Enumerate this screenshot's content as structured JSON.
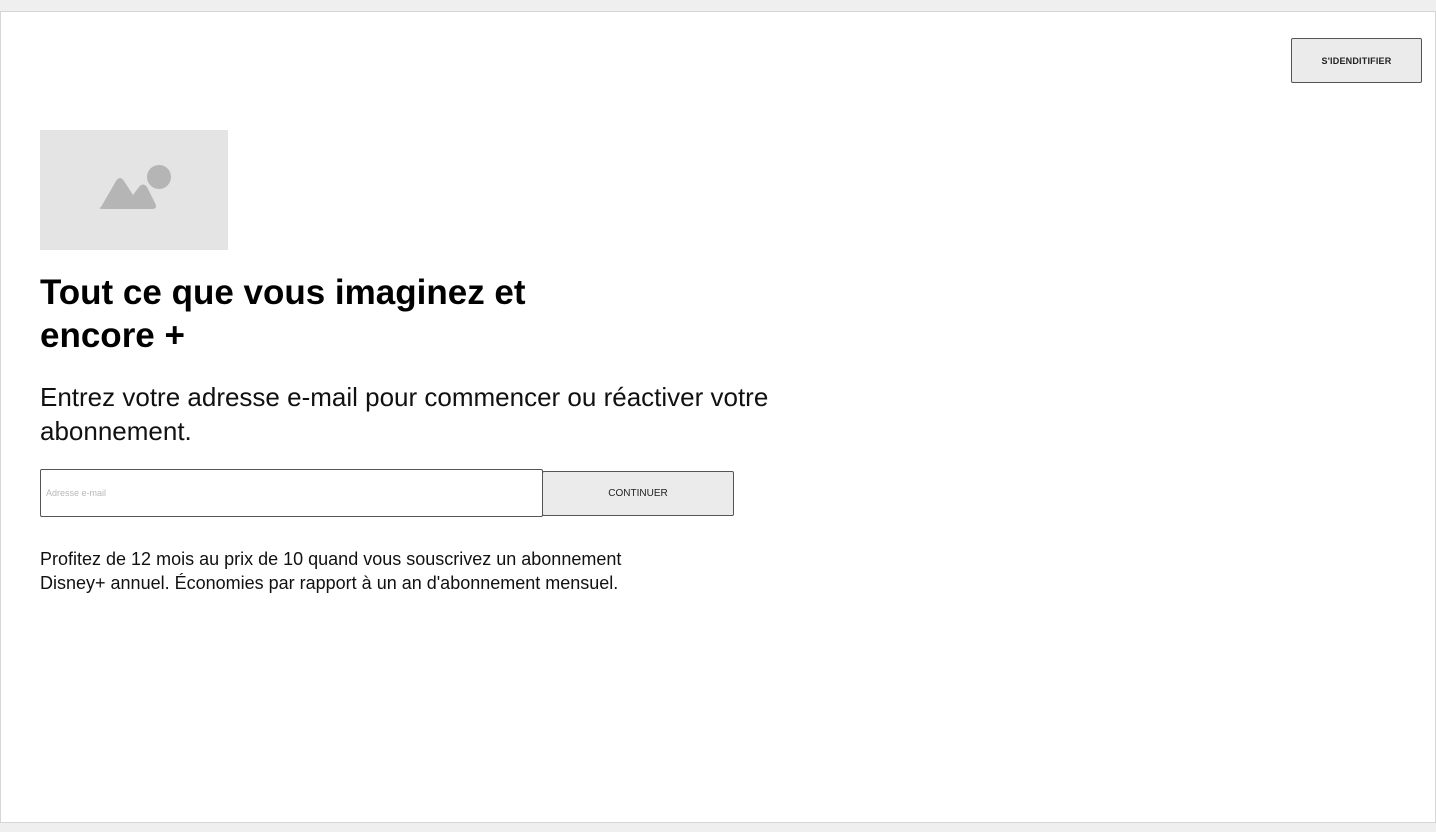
{
  "header": {
    "login_label": "S'IDENDITIFIER"
  },
  "hero": {
    "logo_icon": "image-placeholder-icon",
    "title": "Tout ce que vous imaginez et encore +",
    "subtitle": "Entrez votre adresse e-mail pour commencer ou réactiver votre abonnement."
  },
  "signup": {
    "email_value": "",
    "email_placeholder": "Adresse e-mail",
    "continue_label": "CONTINUER"
  },
  "promo": {
    "text": "Profitez de 12 mois au prix de 10 quand vous souscrivez un abonnement Disney+ annuel. Économies par rapport à un an d'abonnement mensuel."
  },
  "colors": {
    "page_background": "#efefef",
    "frame_background": "#ffffff",
    "button_background": "#ebebeb",
    "placeholder_background": "#e4e4e4",
    "placeholder_icon": "#b5b5b5"
  }
}
